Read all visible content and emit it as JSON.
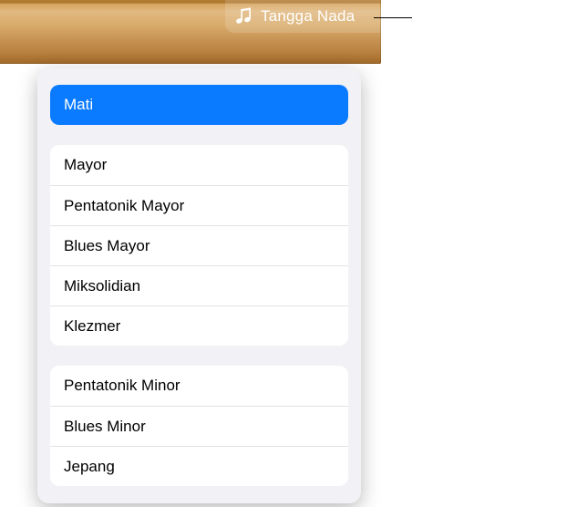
{
  "toolbar": {
    "scale_button_label": "Tangga Nada"
  },
  "popover": {
    "groups": [
      {
        "items": [
          {
            "label": "Mati",
            "selected": true
          }
        ]
      },
      {
        "items": [
          {
            "label": "Mayor"
          },
          {
            "label": "Pentatonik Mayor"
          },
          {
            "label": "Blues Mayor"
          },
          {
            "label": "Miksolidian"
          },
          {
            "label": "Klezmer"
          }
        ]
      },
      {
        "items": [
          {
            "label": "Pentatonik Minor"
          },
          {
            "label": "Blues Minor"
          },
          {
            "label": "Jepang"
          }
        ]
      }
    ]
  }
}
